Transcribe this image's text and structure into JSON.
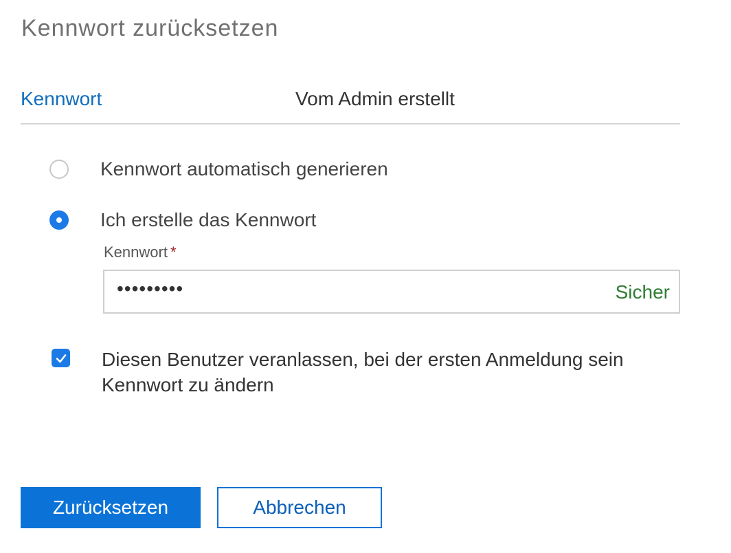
{
  "dialog": {
    "title": "Kennwort zurücksetzen"
  },
  "password_field": {
    "label": "Kennwort",
    "value": "Vom Admin erstellt"
  },
  "options": [
    {
      "label": "Kennwort automatisch generieren",
      "selected": false
    },
    {
      "label": "Ich erstelle das Kennwort",
      "selected": true
    }
  ],
  "password_input": {
    "label": "Kennwort",
    "required_marker": "*",
    "masked_value": "•••••••••",
    "strength": "Sicher"
  },
  "force_change": {
    "checked": true,
    "label": "Diesen Benutzer veranlassen, bei der ersten Anmeldung sein Kennwort zu ändern"
  },
  "buttons": {
    "primary": "Zurücksetzen",
    "secondary": "Abbrechen"
  },
  "colors": {
    "accent": "#0b73d7",
    "link": "#106ebe",
    "strength_ok": "#2e7d32",
    "required": "#a4262c"
  }
}
